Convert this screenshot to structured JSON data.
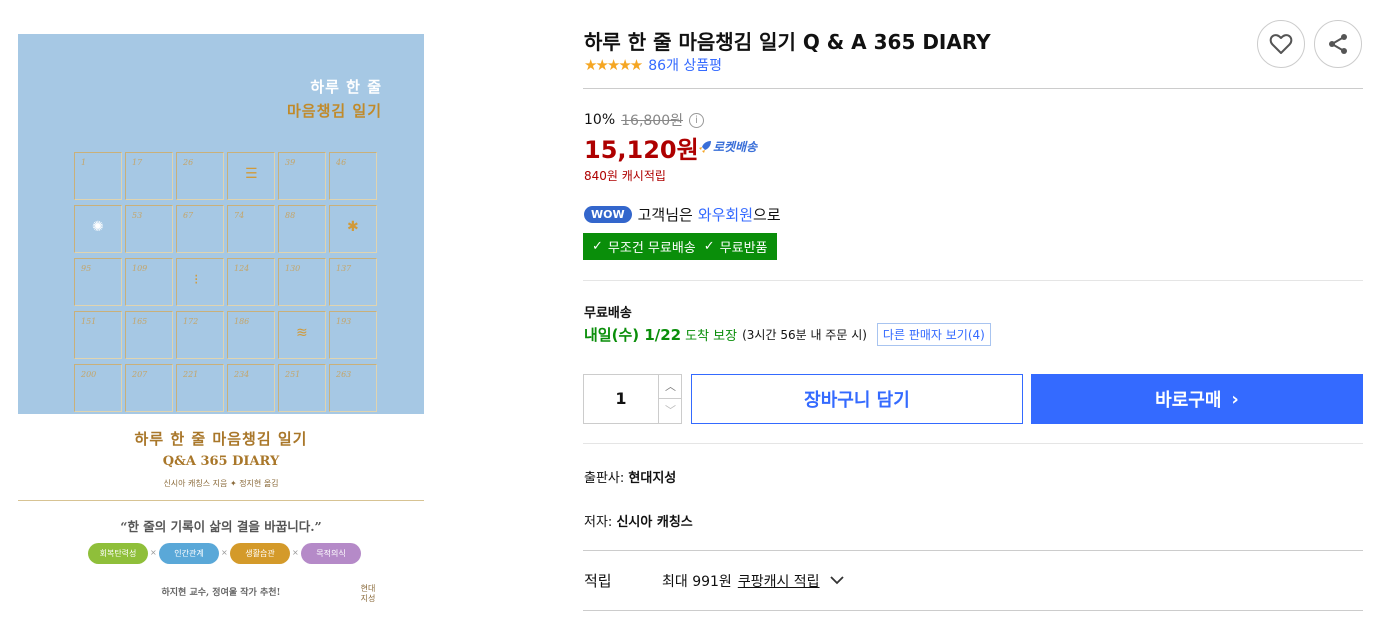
{
  "cover": {
    "title_small_1": "하루 한 줄",
    "title_small_2": "마음챙김 일기",
    "grid_numbers": [
      "1",
      "17",
      "26",
      "",
      "39",
      "46",
      "",
      "53",
      "67",
      "74",
      "88",
      "",
      "95",
      "109",
      "",
      "124",
      "130",
      "137",
      "151",
      "165",
      "172",
      "186",
      "",
      "193",
      "200",
      "207",
      "221",
      "234",
      "251",
      "263"
    ],
    "title_large": "하루 한 줄 마음챙김 일기",
    "subtitle": "Q&A 365 DIARY",
    "authors": "신시아 캐칭스 지음 ✦ 정지현 옮김",
    "quote": "“한 줄의 기록이 삶의 결을 바꿉니다.”",
    "pills": [
      "회복탄력성",
      "인간관계",
      "생활습관",
      "목적의식"
    ],
    "pill_colors": [
      "#8fbf3a",
      "#5aa8d8",
      "#d49a2a",
      "#b58ac8"
    ],
    "recommend": "하지현 교수, 정여울 작가 추천!",
    "publisher_logo": "현대 지성"
  },
  "product": {
    "title": "하루 한 줄 마음챙김 일기 Q & A 365 DIARY",
    "stars": "★★★★★",
    "review_count": "86개 상품평",
    "discount_rate": "10%",
    "original_price": "16,800원",
    "price": "15,120원",
    "rocket_label": "로켓배송",
    "cash_reward": "840원 캐시적립",
    "wow_badge": "WOW",
    "wow_prefix": "고객님은",
    "wow_link": "와우회원",
    "wow_suffix": "으로",
    "free_shipping": "무조건 무료배송",
    "free_return": "무료반품"
  },
  "shipping": {
    "label": "무료배송",
    "arrival": "내일(수) 1/22",
    "arrival_suffix": "도착 보장",
    "note": "(3시간 56분 내 주문 시)",
    "other_sellers": "다른 판매자 보기(4)"
  },
  "purchase": {
    "quantity": "1",
    "cart_label": "장바구니 담기",
    "buy_label": "바로구매"
  },
  "meta": {
    "publisher_label": "출판사:",
    "publisher": "현대지성",
    "author_label": "저자:",
    "author": "신시아 캐칭스"
  },
  "cashback": {
    "label": "적립",
    "max": "최대 991원",
    "link": "쿠팡캐시 적립"
  },
  "colors": {
    "accent": "#346aff",
    "price_red": "#ae0000",
    "green": "#0a8e0a",
    "star": "#f5a623"
  }
}
